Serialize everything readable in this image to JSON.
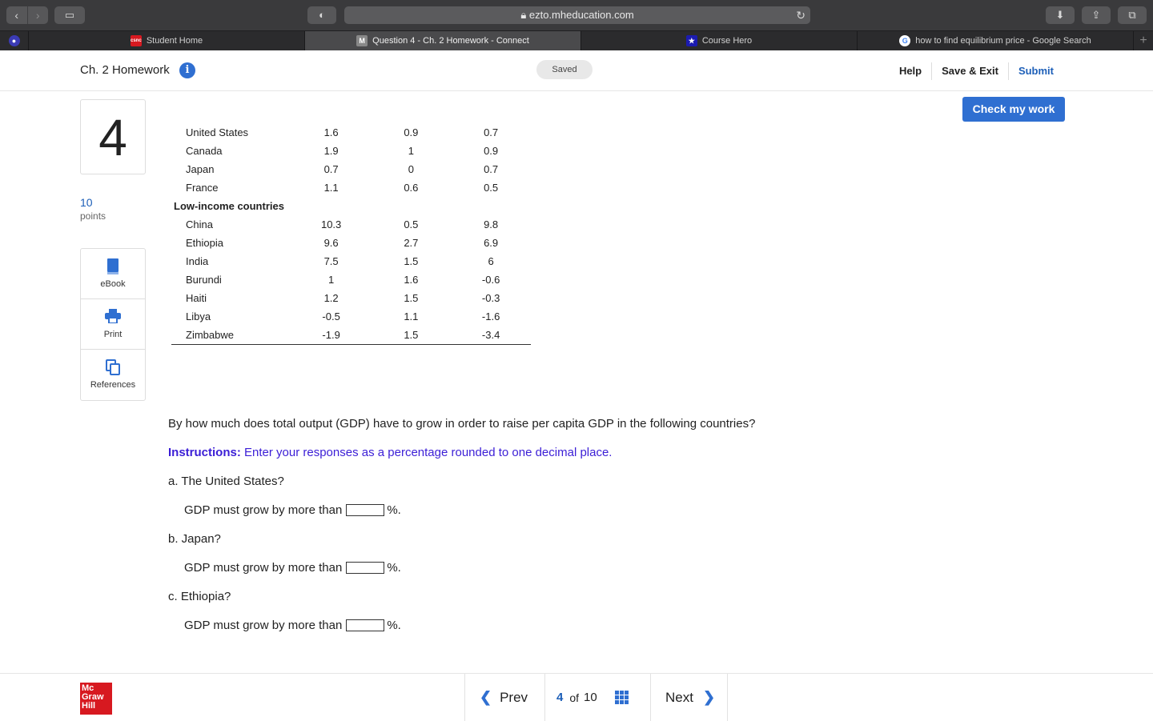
{
  "browser": {
    "url": "ezto.mheducation.com",
    "tabs": [
      {
        "label": "Student Home",
        "favicon": "csnc"
      },
      {
        "label": "Question 4 - Ch. 2 Homework - Connect",
        "favicon": "M"
      },
      {
        "label": "Course Hero",
        "favicon": "star"
      },
      {
        "label": "how to find equilibrium price - Google Search",
        "favicon": "G"
      }
    ]
  },
  "header": {
    "title": "Ch. 2 Homework",
    "status": "Saved",
    "help": "Help",
    "save_exit": "Save & Exit",
    "submit": "Submit"
  },
  "question": {
    "number": "4",
    "points_value": "10",
    "points_label": "points"
  },
  "tools": {
    "ebook": "eBook",
    "print": "Print",
    "references": "References"
  },
  "check_work": "Check my work",
  "table": {
    "rows_top": [
      {
        "country": "United States",
        "a": "1.6",
        "b": "0.9",
        "c": "0.7"
      },
      {
        "country": "Canada",
        "a": "1.9",
        "b": "1",
        "c": "0.9"
      },
      {
        "country": "Japan",
        "a": "0.7",
        "b": "0",
        "c": "0.7"
      },
      {
        "country": "France",
        "a": "1.1",
        "b": "0.6",
        "c": "0.5"
      }
    ],
    "group_label": "Low-income countries",
    "rows_bottom": [
      {
        "country": "China",
        "a": "10.3",
        "b": "0.5",
        "c": "9.8"
      },
      {
        "country": "Ethiopia",
        "a": "9.6",
        "b": "2.7",
        "c": "6.9"
      },
      {
        "country": "India",
        "a": "7.5",
        "b": "1.5",
        "c": "6"
      },
      {
        "country": "Burundi",
        "a": "1",
        "b": "1.6",
        "c": "-0.6"
      },
      {
        "country": "Haiti",
        "a": "1.2",
        "b": "1.5",
        "c": "-0.3"
      },
      {
        "country": "Libya",
        "a": "-0.5",
        "b": "1.1",
        "c": "-1.6"
      },
      {
        "country": "Zimbabwe",
        "a": "-1.9",
        "b": "1.5",
        "c": "-3.4"
      }
    ]
  },
  "prompt": "By how much does total output (GDP) have to grow in order to raise per capita GDP in the following countries?",
  "instructions": {
    "label": "Instructions:",
    "text": "Enter your responses as a percentage rounded to one decimal place."
  },
  "parts": [
    {
      "question": "a. The United States?",
      "answer_prefix": "GDP must grow by more than",
      "answer_value": "",
      "suffix": "%."
    },
    {
      "question": "b. Japan?",
      "answer_prefix": "GDP must grow by more than",
      "answer_value": "",
      "suffix": "%."
    },
    {
      "question": "c. Ethiopia?",
      "answer_prefix": "GDP must grow by more than",
      "answer_value": "",
      "suffix": "%."
    }
  ],
  "footer": {
    "logo": [
      "Mc",
      "Graw",
      "Hill"
    ],
    "prev": "Prev",
    "current": "4",
    "of": "of",
    "total": "10",
    "next": "Next"
  },
  "colors": {
    "accent": "#2f6fd1",
    "instructions": "#3b1ed6",
    "logo": "#d71920"
  }
}
